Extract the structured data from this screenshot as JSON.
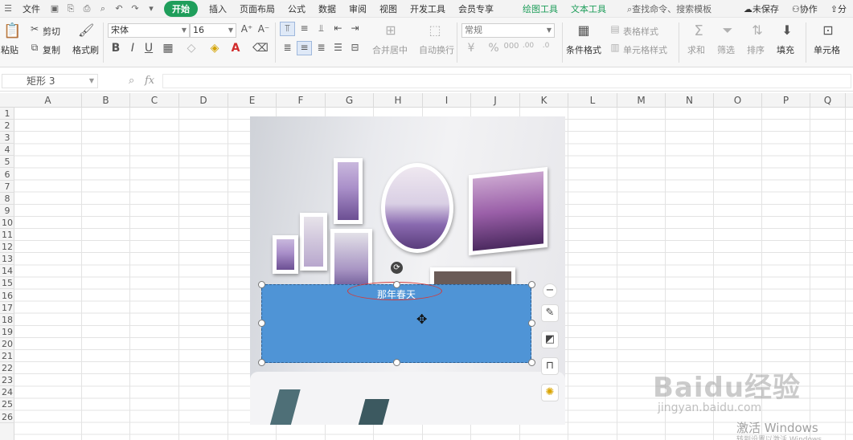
{
  "menubar": {
    "file": "文件",
    "tabs": [
      "开始",
      "插入",
      "页面布局",
      "公式",
      "数据",
      "审阅",
      "视图",
      "开发工具",
      "会员专享"
    ],
    "active_tab": "开始",
    "tool_tabs": [
      "绘图工具",
      "文本工具"
    ],
    "search": "查找命令、搜索模板",
    "unsaved": "未保存",
    "collab": "协作",
    "share": "分"
  },
  "ribbon": {
    "paste": "粘贴",
    "cut": "剪切",
    "copy": "复制",
    "format_painter": "格式刷",
    "font_name": "宋体",
    "font_size": "16",
    "merge_center": "合并居中",
    "wrap_text": "自动换行",
    "number_format": "常规",
    "conditional_format": "条件格式",
    "table_style": "表格样式",
    "cell_style": "单元格样式",
    "sum": "求和",
    "filter": "筛选",
    "sort": "排序",
    "fill": "填充",
    "cell": "单元格"
  },
  "formulabar": {
    "name_box": "矩形 3",
    "fx": "fx"
  },
  "grid": {
    "columns": [
      "A",
      "B",
      "C",
      "D",
      "E",
      "F",
      "G",
      "H",
      "I",
      "J",
      "K",
      "L",
      "M",
      "N",
      "O",
      "P",
      "Q"
    ],
    "rows": [
      "1",
      "2",
      "3",
      "4",
      "5",
      "6",
      "7",
      "8",
      "9",
      "10",
      "11",
      "12",
      "13",
      "14",
      "15",
      "16",
      "17",
      "18",
      "19",
      "20",
      "21",
      "22",
      "23",
      "24",
      "25",
      "26"
    ]
  },
  "shape": {
    "text": "那年春天",
    "fill_color": "#4f94d6",
    "highlight_color": "#d23b3b"
  },
  "watermark": {
    "baidu": "Baidu经验",
    "url": "jingyan.baidu.com",
    "windows": "激活 Windows",
    "windows_sub": "转到设置以激活 Windows。"
  },
  "colors": {
    "accent": "#1f9e5b"
  }
}
